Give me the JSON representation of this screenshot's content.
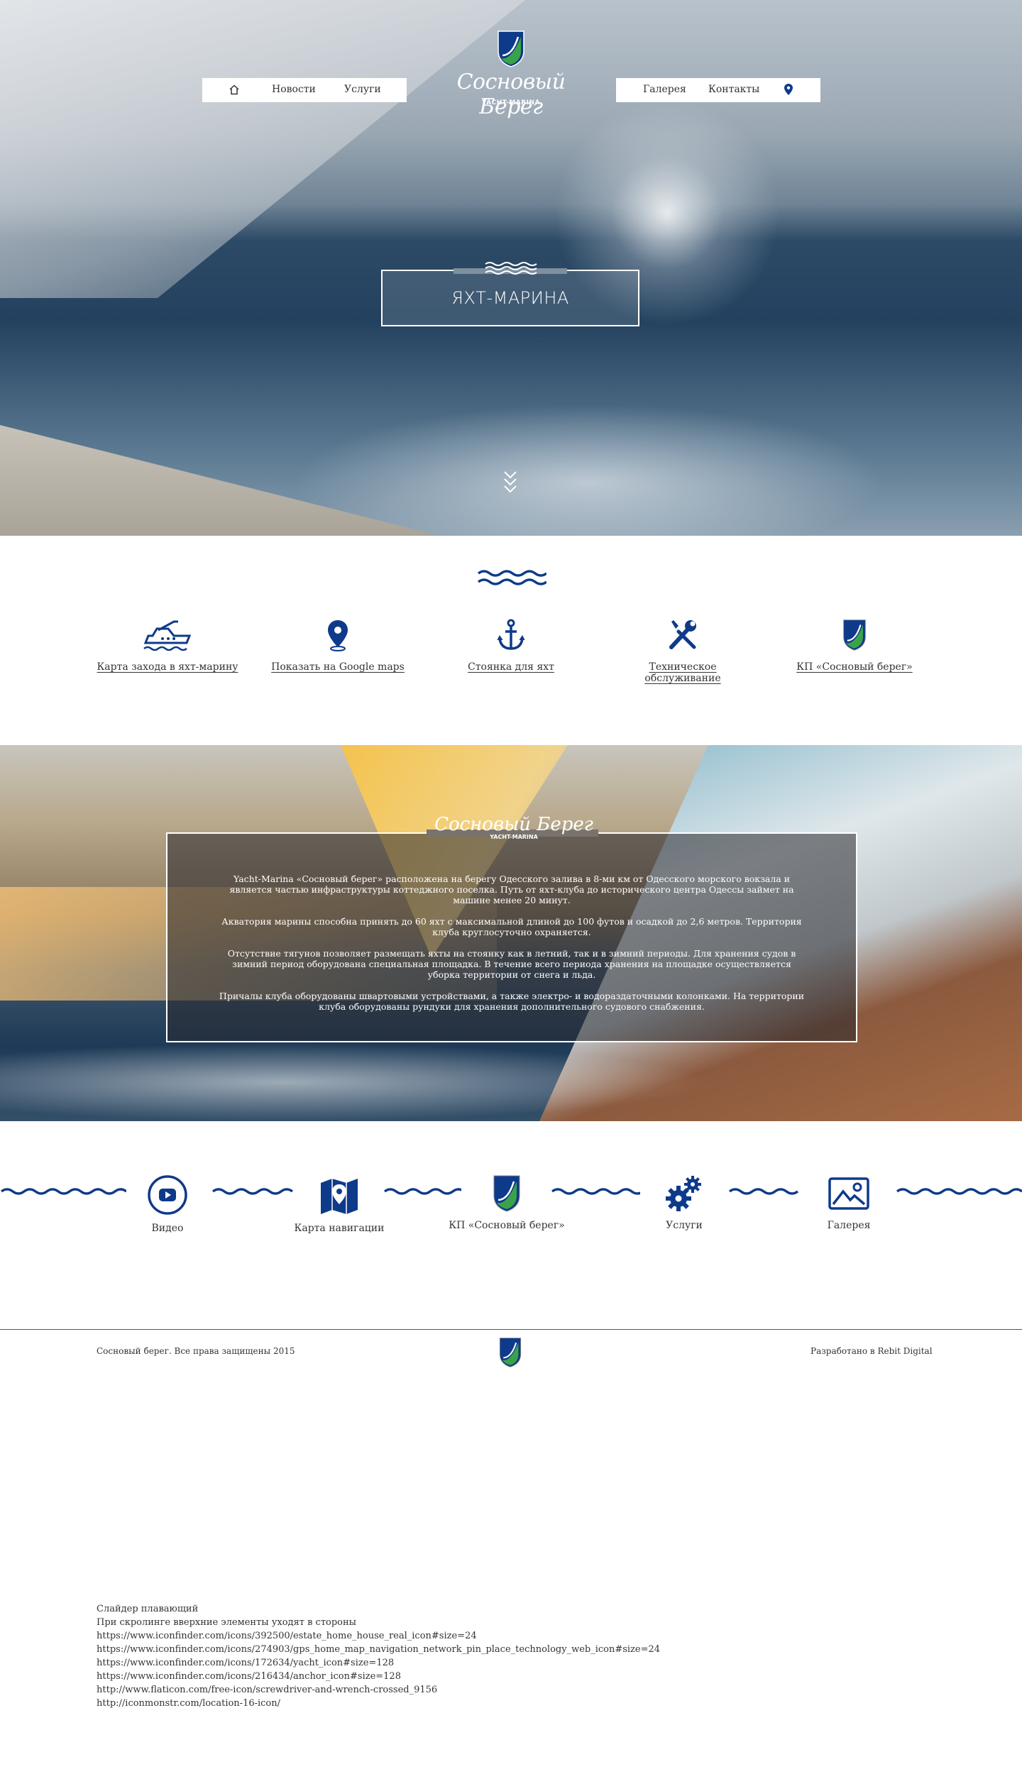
{
  "nav": {
    "left_items": [
      "Новости",
      "Услуги"
    ],
    "right_items": [
      "Галерея",
      "Контакты"
    ]
  },
  "logo": {
    "script": "Сосновый Берег",
    "subtitle": "YACHT-MARINA"
  },
  "hero": {
    "title": "ЯХТ-МАРИНА"
  },
  "services": [
    {
      "label": "Карта захода в яхт-марину",
      "icon": "yacht-icon"
    },
    {
      "label": "Показать на Google maps",
      "icon": "map-pin-icon"
    },
    {
      "label": "Стоянка для яхт",
      "icon": "anchor-icon"
    },
    {
      "label": "Техническое обслуживание",
      "icon": "screwdriver-wrench-icon"
    },
    {
      "label": "КП «Сосновый берег»",
      "icon": "shield-logo-icon"
    }
  ],
  "about": {
    "logo_script": "Сосновый Берег",
    "logo_subtitle": "YACHT-MARINA",
    "paragraphs": [
      "Yacht-Marina «Сосновый берег» расположена на берегу Одесского залива в 8-ми км от Одесского морского вокзала и является частью инфраструктуры коттеджного поселка. Путь от яхт-клуба до исторического центра Одессы займет на машине менее 20 минут.",
      "Акватория марины способна принять до 60 яхт с максимальной длиной до 100 футов и осадкой до 2,6 метров. Территория клуба круглосуточно охраняется.",
      "Отсутствие тягунов позволяет размещать яхты на стоянку как в летний, так и в зимний периоды. Для хранения судов в зимний период оборудована специальная площадка. В течение всего периода хранения на площадке осуществляется уборка территории от снега и льда.",
      "Причалы клуба оборудованы швартовыми устройствами, а также электро- и водораздаточными колонками. На территории клуба оборудованы рундуки для хранения дополнительного судового снабжения."
    ]
  },
  "quick_links": [
    {
      "label": "Видео",
      "icon": "video-play-icon"
    },
    {
      "label": "Карта навигации",
      "icon": "navigation-map-icon"
    },
    {
      "label": "КП «Сосновый берег»",
      "icon": "shield-logo-icon"
    },
    {
      "label": "Услуги",
      "icon": "gears-icon"
    },
    {
      "label": "Галерея",
      "icon": "gallery-image-icon"
    }
  ],
  "footer": {
    "copyright": "Сосновый берег. Все права защищены 2015",
    "developer": "Разработано в Rebit Digital"
  },
  "notes": [
    "Слайдер плавающий",
    "При скролинге вверхние элементы уходят в стороны",
    "https://www.iconfinder.com/icons/392500/estate_home_house_real_icon#size=24",
    "https://www.iconfinder.com/icons/274903/gps_home_map_navigation_network_pin_place_technology_web_icon#size=24",
    "https://www.iconfinder.com/icons/172634/yacht_icon#size=128",
    "https://www.iconfinder.com/icons/216434/anchor_icon#size=128",
    "http://www.flaticon.com/free-icon/screwdriver-and-wrench-crossed_9156",
    "http://iconmonstr.com/location-16-icon/"
  ],
  "colors": {
    "brand_blue": "#0e3a8a",
    "brand_green": "#3aa34a"
  }
}
